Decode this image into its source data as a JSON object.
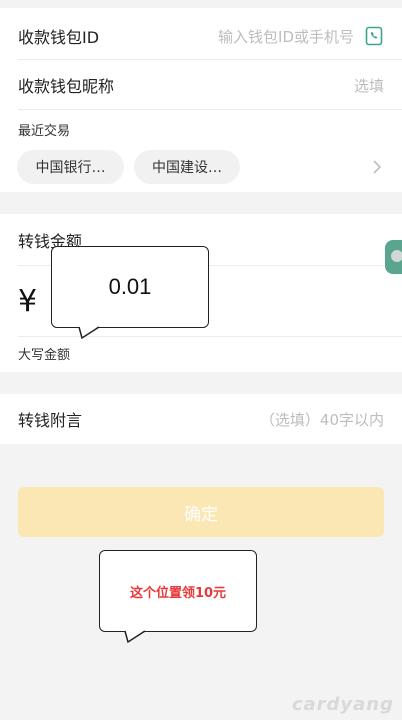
{
  "wallet": {
    "id_label": "收款钱包ID",
    "id_placeholder": "输入钱包ID或手机号",
    "nickname_label": "收款钱包昵称",
    "nickname_placeholder": "选填",
    "recent_label": "最近交易",
    "recent_items": [
      "中国银行…",
      "中国建设…"
    ]
  },
  "amount": {
    "label": "转钱金额",
    "currency": "¥",
    "uppercase_label": "大写金额"
  },
  "note": {
    "label": "转钱附言",
    "placeholder": "（选填）40字以内"
  },
  "confirm": {
    "label": "确定"
  },
  "callouts": {
    "amount_value": "0.01",
    "promo_text": "这个位置领10元"
  },
  "watermark": "cardyang",
  "colors": {
    "confirm_bg": "#fbe7b4",
    "confirm_text": "#ffffff",
    "promo_text": "#e8393a",
    "icon_green": "#3aa58a",
    "side_tab": "#5aa58f"
  }
}
